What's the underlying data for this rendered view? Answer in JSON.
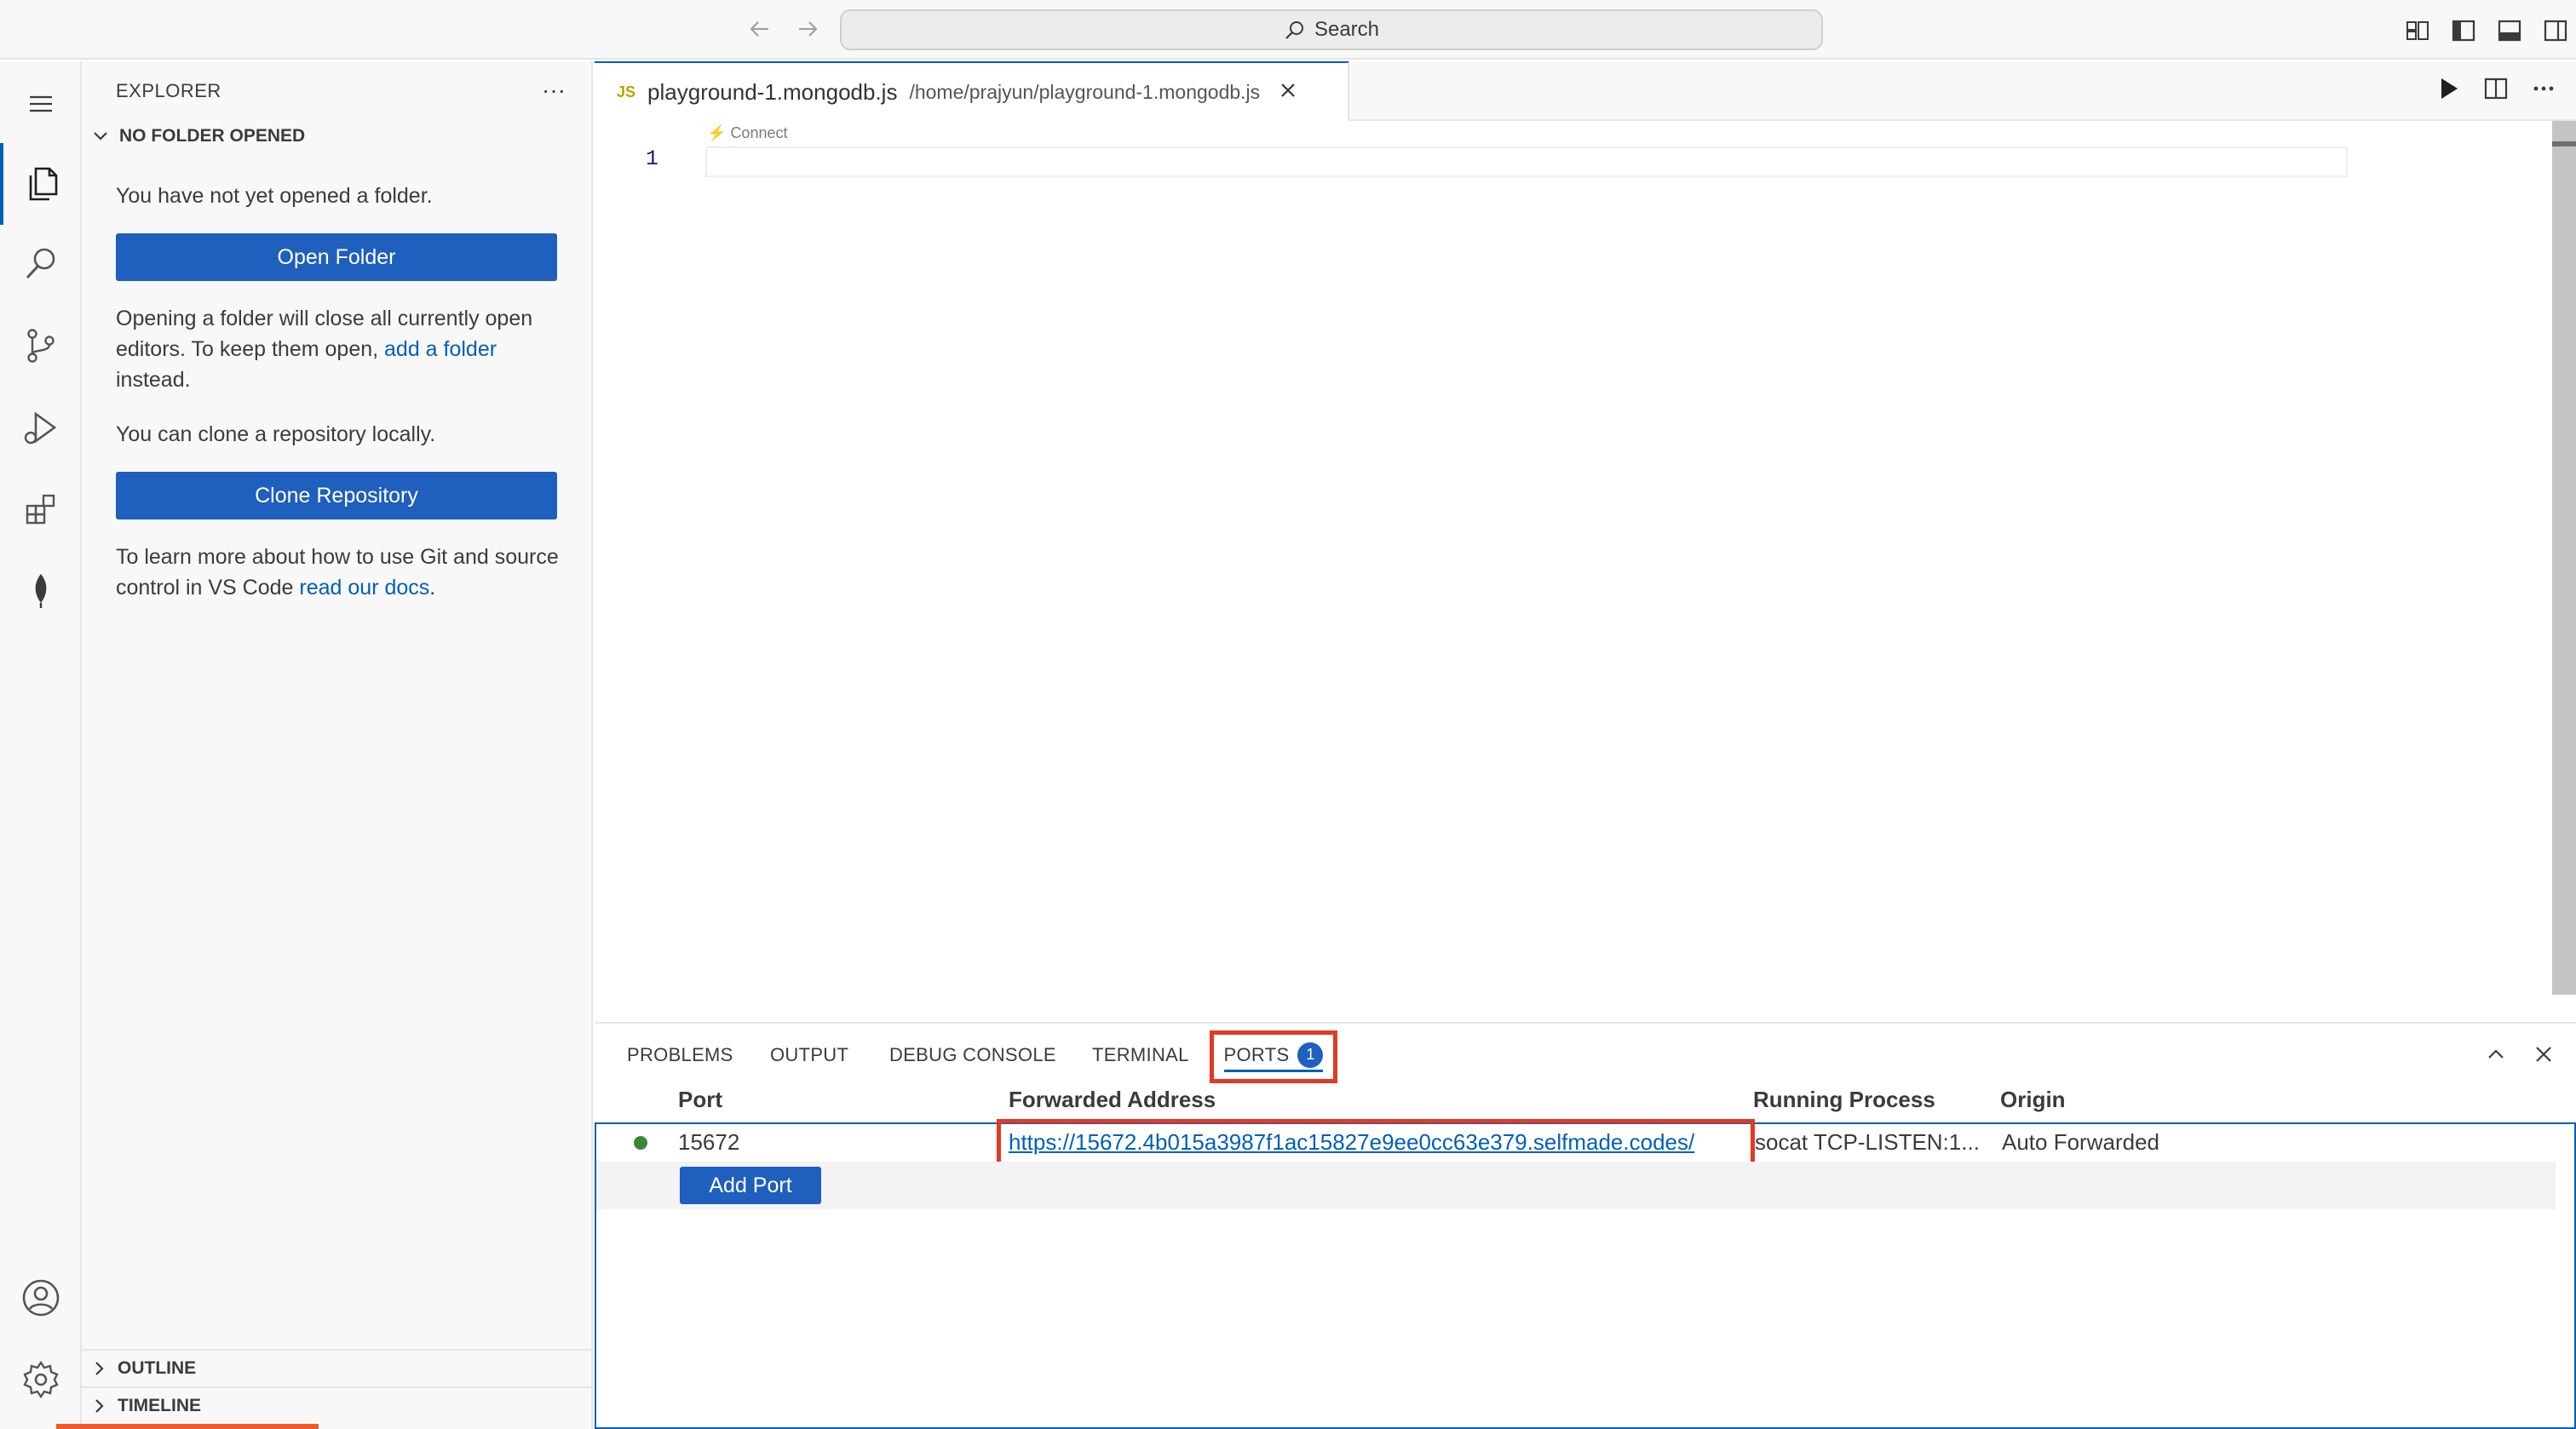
{
  "titlebar": {
    "search_label": "Search"
  },
  "sidebar": {
    "title": "EXPLORER",
    "more": "···",
    "section": "NO FOLDER OPENED",
    "no_folder_text": "You have not yet opened a folder.",
    "open_folder_button": "Open Folder",
    "close_editors_text_1": "Opening a folder will close all currently open editors. To keep them open, ",
    "add_folder_link": "add a folder",
    "close_editors_text_2": " instead.",
    "clone_text": "You can clone a repository locally.",
    "clone_button": "Clone Repository",
    "git_text_1": "To learn more about how to use Git and source control in VS Code ",
    "docs_link": "read our docs",
    "git_text_2": ".",
    "outline": "OUTLINE",
    "timeline": "TIMELINE"
  },
  "editor": {
    "tab_icon": "JS",
    "tab_name": "playground-1.mongodb.js",
    "tab_path": "/home/prajyun/playground-1.mongodb.js",
    "codelens": "Connect",
    "line_number": "1"
  },
  "panel": {
    "tabs": [
      "PROBLEMS",
      "OUTPUT",
      "DEBUG CONSOLE",
      "TERMINAL"
    ],
    "ports_tab": "PORTS",
    "ports_badge": "1",
    "columns": {
      "port": "Port",
      "address": "Forwarded Address",
      "process": "Running Process",
      "origin": "Origin"
    },
    "rows": [
      {
        "port": "15672",
        "address": "https://15672.4b015a3987f1ac15827e9ee0cc63e379.selfmade.codes/",
        "process": "socat TCP-LISTEN:1...",
        "origin": "Auto Forwarded"
      }
    ],
    "add_port_button": "Add Port"
  },
  "colors": {
    "accent": "#005fb8",
    "button": "#1f5fbd",
    "highlight": "#e03a26",
    "status_ok": "#388a34"
  },
  "icons": {
    "activity": [
      "menu-icon",
      "explorer-icon",
      "search-icon",
      "source-control-icon",
      "run-debug-icon",
      "extensions-icon",
      "mongodb-leaf-icon",
      "account-icon",
      "settings-gear-icon"
    ]
  }
}
